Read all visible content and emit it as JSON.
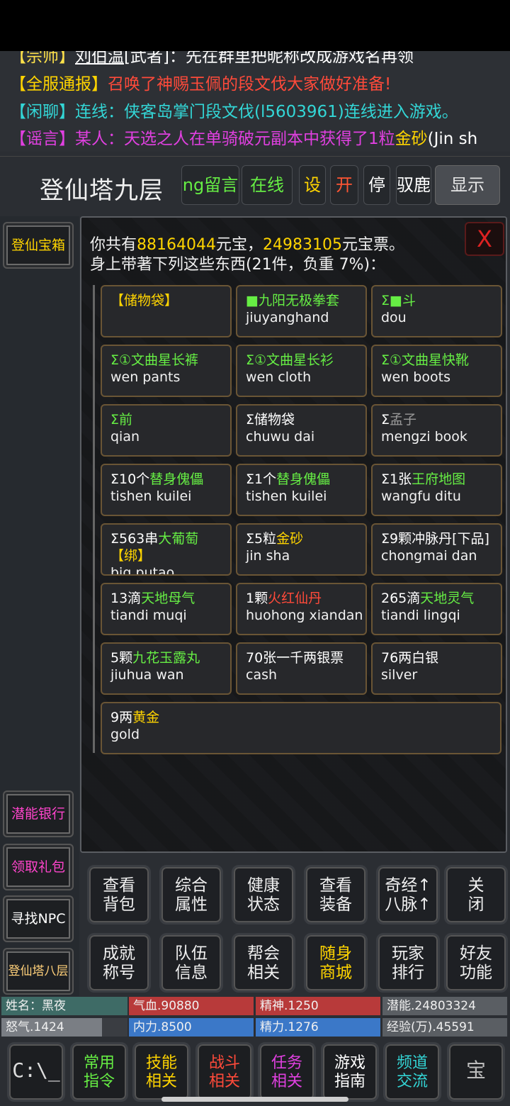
{
  "chat": [
    {
      "tag": "【宗师】",
      "tag_color": "#ffe24a",
      "name": "刘伯温",
      "name_color": "#ffffff",
      "extra": "[武者]：先在群里把昵称改成游戏名再领",
      "extra_color": "#ffffff"
    },
    {
      "tag": "【全服通报】",
      "tag_color": "#ffd400",
      "body": "召唤了神赐玉佩的段文伐大家做好准备!",
      "body_color": "#ff4a3a"
    },
    {
      "tag": "【闲聊】",
      "tag_color": "#33d6d6",
      "body": "连线：侠客岛掌门段文伐(l5603961)连线进入游戏。",
      "body_color": "#33d6d6"
    },
    {
      "tag": "【谣言】",
      "tag_color": "#e040e0",
      "body": "某人：天选之人在单骑破元副本中获得了1粒",
      "body_color": "#e040e0",
      "item": "金砂",
      "item_color": "#ffd400",
      "tail": "(Jin sh",
      "tail_color": "#ffffff"
    }
  ],
  "header": {
    "title": "登仙塔九层",
    "buttons": [
      {
        "label": "ng留言",
        "color": "#66ee44"
      },
      {
        "label": "在线",
        "color": "#66ee44"
      },
      {
        "label": "设",
        "color": "#ffd400"
      },
      {
        "label": "开",
        "color": "#ff5533"
      },
      {
        "label": "停",
        "color": "#ffffff"
      },
      {
        "label": "驭鹿",
        "color": "#ffffff"
      },
      {
        "label": "显示",
        "color": "#e6e6e6"
      }
    ]
  },
  "sidebar": [
    {
      "label": "登仙宝箱",
      "color": "#ffd400"
    },
    {
      "label": "潜能银行",
      "color": "#ff44cc"
    },
    {
      "label": "领取礼包",
      "color": "#ff44cc"
    },
    {
      "label": "寻找NPC",
      "color": "#ffffff"
    },
    {
      "label": "登仙塔八层",
      "color": "#ffd07a"
    }
  ],
  "inventory": {
    "line1_pre": "你共有",
    "yuanbao": "88164044",
    "line1_mid": "元宝，",
    "yuanbaopiao": "24983105",
    "line1_post": "元宝票。",
    "line2": "身上带著下列这些东西(21件，负重 7%)：",
    "close_label": "X",
    "items": [
      {
        "parts": [
          {
            "t": "【储物袋】",
            "c": "#ffd400"
          }
        ],
        "en": ""
      },
      {
        "parts": [
          {
            "t": "■九阳无极拳套",
            "c": "#66ee44"
          }
        ],
        "en": "jiuyanghand"
      },
      {
        "parts": [
          {
            "t": "Σ■斗",
            "c": "#66ee44"
          }
        ],
        "en": "dou"
      },
      {
        "parts": [
          {
            "t": "Σ①文曲星长裤",
            "c": "#66ee44"
          }
        ],
        "en": "wen pants"
      },
      {
        "parts": [
          {
            "t": "Σ①文曲星长衫",
            "c": "#66ee44"
          }
        ],
        "en": "wen cloth"
      },
      {
        "parts": [
          {
            "t": "Σ①文曲星快靴",
            "c": "#66ee44"
          }
        ],
        "en": "wen boots"
      },
      {
        "parts": [
          {
            "t": "Σ前",
            "c": "#66ee44"
          }
        ],
        "en": "qian"
      },
      {
        "parts": [
          {
            "t": "Σ储物袋",
            "c": "#ffffff"
          }
        ],
        "en": "chuwu dai"
      },
      {
        "parts": [
          {
            "t": "Σ",
            "c": "#ffffff"
          },
          {
            "t": "孟子",
            "c": "#999999"
          }
        ],
        "en": "mengzi book"
      },
      {
        "parts": [
          {
            "t": "Σ10个",
            "c": "#ffffff"
          },
          {
            "t": "替身傀儡",
            "c": "#66ee44"
          }
        ],
        "en": "tishen kuilei"
      },
      {
        "parts": [
          {
            "t": "Σ1个",
            "c": "#ffffff"
          },
          {
            "t": "替身傀儡",
            "c": "#66ee44"
          }
        ],
        "en": "tishen kuilei"
      },
      {
        "parts": [
          {
            "t": "Σ1张",
            "c": "#ffffff"
          },
          {
            "t": "王府地图",
            "c": "#66ee44"
          }
        ],
        "en": "wangfu ditu"
      },
      {
        "parts": [
          {
            "t": "Σ563串",
            "c": "#ffffff"
          },
          {
            "t": "大葡萄",
            "c": "#66ee44"
          }
        ],
        "line1b": "【绑】",
        "line1b_color": "#ffd400",
        "en": "big putao"
      },
      {
        "parts": [
          {
            "t": "Σ5粒",
            "c": "#ffffff"
          },
          {
            "t": "金砂",
            "c": "#ffd400"
          }
        ],
        "en": "jin sha"
      },
      {
        "parts": [
          {
            "t": "Σ9颗冲脉丹[下品]",
            "c": "#ffffff"
          }
        ],
        "en": "chongmai dan"
      },
      {
        "parts": [
          {
            "t": "13滴",
            "c": "#ffffff"
          },
          {
            "t": "天地母气",
            "c": "#66ee44"
          }
        ],
        "en": "tiandi muqi"
      },
      {
        "parts": [
          {
            "t": "1颗",
            "c": "#ffffff"
          },
          {
            "t": "火红仙丹",
            "c": "#ff4a3a"
          }
        ],
        "en": "huohong xiandan"
      },
      {
        "parts": [
          {
            "t": "265滴",
            "c": "#ffffff"
          },
          {
            "t": "天地灵气",
            "c": "#66ee44"
          }
        ],
        "en": "tiandi lingqi"
      },
      {
        "parts": [
          {
            "t": "5颗",
            "c": "#ffffff"
          },
          {
            "t": "九花玉露丸",
            "c": "#66ee44"
          }
        ],
        "en": "jiuhua wan"
      },
      {
        "parts": [
          {
            "t": "70张一千两银票",
            "c": "#ffffff"
          }
        ],
        "en": "cash"
      },
      {
        "parts": [
          {
            "t": "76两白银",
            "c": "#ffffff"
          }
        ],
        "en": "silver"
      },
      {
        "parts": [
          {
            "t": "9两",
            "c": "#ffffff"
          },
          {
            "t": "黄金",
            "c": "#ffd400"
          }
        ],
        "en": "gold"
      }
    ]
  },
  "actions": [
    {
      "l1": "查看",
      "l2": "背包",
      "color": "#f0f0f0"
    },
    {
      "l1": "综合",
      "l2": "属性",
      "color": "#f0f0f0"
    },
    {
      "l1": "健康",
      "l2": "状态",
      "color": "#f0f0f0"
    },
    {
      "l1": "查看",
      "l2": "装备",
      "color": "#f0f0f0"
    },
    {
      "l1": "奇经↑",
      "l2": "八脉↑",
      "color": "#f0f0f0"
    },
    {
      "l1": "关",
      "l2": "闭",
      "color": "#f0f0f0"
    },
    {
      "l1": "成就",
      "l2": "称号",
      "color": "#f0f0f0"
    },
    {
      "l1": "队伍",
      "l2": "信息",
      "color": "#f0f0f0"
    },
    {
      "l1": "帮会",
      "l2": "相关",
      "color": "#f0f0f0"
    },
    {
      "l1": "随身",
      "l2": "商城",
      "color": "#ffd400"
    },
    {
      "l1": "玩家",
      "l2": "排行",
      "color": "#f0f0f0"
    },
    {
      "l1": "好友",
      "l2": "功能",
      "color": "#f0f0f0"
    }
  ],
  "stats": [
    {
      "label": "姓名：黑夜",
      "bg": "#3e6b66",
      "fill": 1
    },
    {
      "label": "气血.90880",
      "bg": "#b83a3a",
      "fill": 1
    },
    {
      "label": "精神.1250",
      "bg": "#b83a3a",
      "fill": 1
    },
    {
      "label": "潜能.24803324",
      "bg": "#5a5e63",
      "fill": 1
    },
    {
      "label": "怒气.1424",
      "bg": "#7a7e84",
      "fill": 0.8
    },
    {
      "label": "内力.8500",
      "bg": "#3b78c8",
      "fill": 1
    },
    {
      "label": "精力.1276",
      "bg": "#3b78c8",
      "fill": 1
    },
    {
      "label": "经验(万).45591",
      "bg": "#5a5e63",
      "fill": 1
    }
  ],
  "bottom_nav": [
    {
      "l1": "C:\\_",
      "l2": "",
      "color": "#dddddd",
      "icon": "console-icon"
    },
    {
      "l1": "常用",
      "l2": "指令",
      "color": "#66ee44"
    },
    {
      "l1": "技能",
      "l2": "相关",
      "color": "#ffd400"
    },
    {
      "l1": "战斗",
      "l2": "相关",
      "color": "#ff4a3a"
    },
    {
      "l1": "任务",
      "l2": "相关",
      "color": "#e040e0"
    },
    {
      "l1": "游戏",
      "l2": "指南",
      "color": "#ffffff"
    },
    {
      "l1": "频道",
      "l2": "交流",
      "color": "#33d6d6"
    },
    {
      "l1": "宝",
      "l2": "",
      "color": "#bbbbbb",
      "icon": "treasure-icon"
    }
  ]
}
